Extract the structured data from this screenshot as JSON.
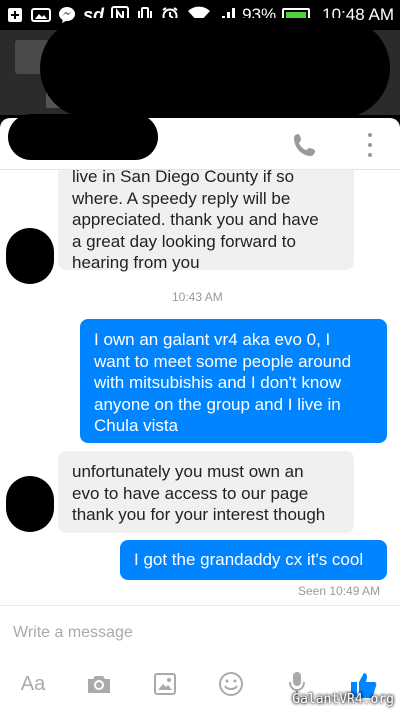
{
  "status_bar": {
    "battery_percent": "93%",
    "time": "10:48 AM",
    "icons": [
      "add-icon",
      "image-icon",
      "messenger-icon",
      "sd-icon",
      "nfc-icon",
      "vibrate-icon",
      "alarm-icon",
      "wifi-icon",
      "signal-icon",
      "battery-icon"
    ],
    "sd_label": "sd"
  },
  "chat": {
    "messages": [
      {
        "from": "them",
        "text_lines": [
          "live in San Diego County if so",
          "where. A speedy reply will be",
          "appreciated. thank you and have",
          "a great day looking forward to",
          "hearing from you"
        ]
      },
      {
        "timestamp": "10:43 AM"
      },
      {
        "from": "me",
        "text_lines": [
          "I own an galant vr4 aka evo 0, I",
          "want to meet some people around",
          "with mitsubishis and I  don't know",
          "anyone on the group and I live in",
          "Chula vista"
        ]
      },
      {
        "from": "them",
        "text_lines": [
          "unfortunately you must own an",
          "evo to have access to our page",
          "thank you for your interest though"
        ]
      },
      {
        "from": "me",
        "text_lines": [
          "I got the grandaddy cx it's cool"
        ]
      }
    ],
    "seen": "Seen 10:49 AM"
  },
  "composer": {
    "placeholder": "Write a message",
    "toolbar": {
      "text_button": "Aa",
      "icons": [
        "camera-icon",
        "gallery-icon",
        "emoji-icon",
        "microphone-icon",
        "like-icon"
      ]
    }
  },
  "watermark": "GalantVR4.org",
  "colors": {
    "outgoing": "#0084ff",
    "incoming": "#f1f0f0",
    "battery": "#4cd33a"
  }
}
